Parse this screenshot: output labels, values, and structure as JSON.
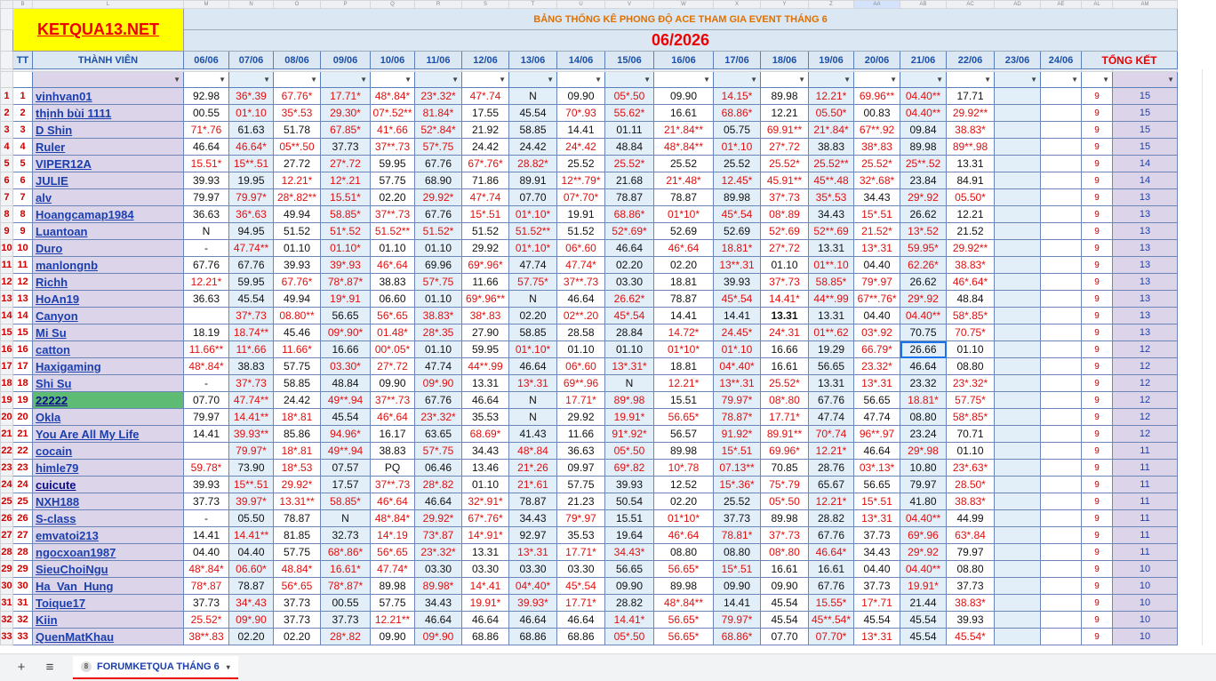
{
  "app": {
    "title": "KETQUA13.NET",
    "subtitle": "BẢNG THỐNG KÊ PHONG ĐỘ ACE THAM GIA EVENT THÁNG 6",
    "month": "06/2026"
  },
  "column_letters": [
    "",
    "B",
    "L",
    "M",
    "N",
    "O",
    "P",
    "Q",
    "R",
    "S",
    "T",
    "U",
    "V",
    "W",
    "X",
    "Y",
    "Z",
    "AA",
    "AB",
    "AC",
    "AD",
    "AE",
    "AL",
    "AM"
  ],
  "header": {
    "tt": "TT",
    "member": "THÀNH VIÊN",
    "dates": [
      "06/06",
      "07/06",
      "08/06",
      "09/06",
      "10/06",
      "11/06",
      "12/06",
      "13/06",
      "14/06",
      "15/06",
      "16/06",
      "17/06",
      "18/06",
      "19/06",
      "20/06",
      "21/06",
      "22/06",
      "23/06",
      "24/06"
    ],
    "summary": "TỔNG KẾT"
  },
  "rows": [
    {
      "tt": "1",
      "name": "vinhvan01",
      "vals": [
        "92.98",
        "36*.39",
        "67.76*",
        "17.71*",
        "48*.84*",
        "23*.32*",
        "47*.74",
        "N",
        "09.90",
        "05*.50",
        "09.90",
        "14.15*",
        "89.98",
        "12.21*",
        "69.96**",
        "04.40**",
        "17.71",
        "",
        ""
      ],
      "g": "9",
      "t": "15"
    },
    {
      "tt": "2",
      "name": "thịnh bùi 1111",
      "vals": [
        "00.55",
        "01*.10",
        "35*.53",
        "29.30*",
        "07*.52**",
        "81.84*",
        "17.55",
        "45.54",
        "70*.93",
        "55.62*",
        "16.61",
        "68.86*",
        "12.21",
        "05.50*",
        "00.83",
        "04.40**",
        "29.92**",
        "",
        ""
      ],
      "g": "9",
      "t": "15"
    },
    {
      "tt": "3",
      "name": "D Shin",
      "vals": [
        "71*.76",
        "61.63",
        "51.78",
        "67.85*",
        "41*.66",
        "52*.84*",
        "21.92",
        "58.85",
        "14.41",
        "01.11",
        "21*.84**",
        "05.75",
        "69.91**",
        "21*.84*",
        "67**.92",
        "09.84",
        "38.83*",
        "",
        ""
      ],
      "g": "9",
      "t": "15"
    },
    {
      "tt": "4",
      "name": "Ruler",
      "vals": [
        "46.64",
        "46.64*",
        "05**.50",
        "37.73",
        "37**.73",
        "57*.75",
        "24.42",
        "24.42",
        "24*.42",
        "48.84",
        "48*.84**",
        "01*.10",
        "27*.72",
        "38.83",
        "38*.83",
        "89.98",
        "89**.98",
        "",
        ""
      ],
      "g": "9",
      "t": "15"
    },
    {
      "tt": "5",
      "name": "VIPER12A",
      "vals": [
        "15.51*",
        "15**.51",
        "27.72",
        "27*.72",
        "59.95",
        "67.76",
        "67*.76*",
        "28.82*",
        "25.52",
        "25.52*",
        "25.52",
        "25.52",
        "25.52*",
        "25.52**",
        "25.52*",
        "25**.52",
        "13.31",
        "",
        ""
      ],
      "g": "9",
      "t": "14"
    },
    {
      "tt": "6",
      "name": "JULIE",
      "vals": [
        "39.93",
        "19.95",
        "12.21*",
        "12*.21",
        "57.75",
        "68.90",
        "71.86",
        "89.91",
        "12**.79*",
        "21.68",
        "21*.48*",
        "12.45*",
        "45.91**",
        "45**.48",
        "32*.68*",
        "23.84",
        "84.91",
        "",
        ""
      ],
      "g": "9",
      "t": "14"
    },
    {
      "tt": "7",
      "name": "alv",
      "vals": [
        "79.97",
        "79.97*",
        "28*.82**",
        "15.51*",
        "02.20",
        "29.92*",
        "47*.74",
        "07.70",
        "07*.70*",
        "78.87",
        "78.87",
        "89.98",
        "37*.73",
        "35*.53",
        "34.43",
        "29*.92",
        "05.50*",
        "",
        ""
      ],
      "g": "9",
      "t": "13"
    },
    {
      "tt": "8",
      "name": "Hoangcamap1984",
      "vals": [
        "36.63",
        "36*.63",
        "49.94",
        "58.85*",
        "37**.73",
        "67.76",
        "15*.51",
        "01*.10*",
        "19.91",
        "68.86*",
        "01*10*",
        "45*.54",
        "08*.89",
        "34.43",
        "15*.51",
        "26.62",
        "12.21",
        "",
        ""
      ],
      "g": "9",
      "t": "13"
    },
    {
      "tt": "9",
      "name": "Luantoan",
      "vals": [
        "N",
        "94.95",
        "51.52",
        "51*.52",
        "51.52**",
        "51.52*",
        "51.52",
        "51.52**",
        "51.52",
        "52*.69*",
        "52.69",
        "52.69",
        "52*.69",
        "52**.69",
        "21.52*",
        "13*.52",
        "21.52",
        "",
        ""
      ],
      "g": "9",
      "t": "13"
    },
    {
      "tt": "10",
      "name": "Duro",
      "vals": [
        "-",
        "47.74**",
        "01.10",
        "01.10*",
        "01.10",
        "01.10",
        "29.92",
        "01*.10*",
        "06*.60",
        "46.64",
        "46*.64",
        "18.81*",
        "27*.72",
        "13.31",
        "13*.31",
        "59.95*",
        "29.92**",
        "",
        ""
      ],
      "g": "9",
      "t": "13"
    },
    {
      "tt": "11",
      "name": "manlongnb",
      "vals": [
        "67.76",
        "67.76",
        "39.93",
        "39*.93",
        "46*.64",
        "69.96",
        "69*.96*",
        "47.74",
        "47.74*",
        "02.20",
        "02.20",
        "13**.31",
        "01.10",
        "01**.10",
        "04.40",
        "62.26*",
        "38.83*",
        "",
        ""
      ],
      "g": "9",
      "t": "13"
    },
    {
      "tt": "12",
      "name": "Richh",
      "vals": [
        "12.21*",
        "59.95",
        "67.76*",
        "78*.87*",
        "38.83",
        "57*.75",
        "11.66",
        "57.75*",
        "37**.73",
        "03.30",
        "18.81",
        "39.93",
        "37*.73",
        "58.85*",
        "79*.97",
        "26.62",
        "46*.64*",
        "",
        ""
      ],
      "g": "9",
      "t": "13"
    },
    {
      "tt": "13",
      "name": "HoAn19",
      "vals": [
        "36.63",
        "45.54",
        "49.94",
        "19*.91",
        "06.60",
        "01.10",
        "69*.96**",
        "N",
        "46.64",
        "26.62*",
        "78.87",
        "45*.54",
        "14.41*",
        "44**.99",
        "67**.76*",
        "29*.92",
        "48.84",
        "",
        ""
      ],
      "g": "9",
      "t": "13"
    },
    {
      "tt": "14",
      "name": "Canyon",
      "vals": [
        "",
        "37*.73",
        "08.80**",
        "56.65",
        "56*.65",
        "38.83*",
        "38*.83",
        "02.20",
        "02**.20",
        "45*.54",
        "14.41",
        "14.41",
        "13.31",
        "13.31",
        "04.40",
        "04.40**",
        "58*.85*",
        "",
        ""
      ],
      "g": "9",
      "t": "13"
    },
    {
      "tt": "15",
      "name": "Mi Su",
      "vals": [
        "18.19",
        "18.74**",
        "45.46",
        "09*.90*",
        "01.48*",
        "28*.35",
        "27.90",
        "58.85",
        "28.58",
        "28.84",
        "14.72*",
        "24.45*",
        "24*.31",
        "01**.62",
        "03*.92",
        "70.75",
        "70.75*",
        "",
        ""
      ],
      "g": "9",
      "t": "13"
    },
    {
      "tt": "16",
      "name": "catton",
      "vals": [
        "11.66**",
        "11*.66",
        "11.66*",
        "16.66",
        "00*.05*",
        "01.10",
        "59.95",
        "01*.10*",
        "01.10",
        "01.10",
        "01*10*",
        "01*.10",
        "16.66",
        "19.29",
        "66.79*",
        "26.66",
        "01.10",
        "",
        ""
      ],
      "g": "9",
      "t": "12"
    },
    {
      "tt": "17",
      "name": "Haxigaming",
      "vals": [
        "48*.84*",
        "38.83",
        "57.75",
        "03.30*",
        "27*.72",
        "47.74",
        "44**.99",
        "46.64",
        "06*.60",
        "13*.31*",
        "18.81",
        "04*.40*",
        "16.61",
        "56.65",
        "23.32*",
        "46.64",
        "08.80",
        "",
        ""
      ],
      "g": "9",
      "t": "12"
    },
    {
      "tt": "18",
      "name": "Shi Su",
      "vals": [
        "-",
        "37*.73",
        "58.85",
        "48.84",
        "09.90",
        "09*.90",
        "13.31",
        "13*.31",
        "69**.96",
        "N",
        "12.21*",
        "13**.31",
        "25.52*",
        "13.31",
        "13*.31",
        "23.32",
        "23*.32*",
        "",
        ""
      ],
      "g": "9",
      "t": "12"
    },
    {
      "tt": "19",
      "name": "22222",
      "vals": [
        "07.70",
        "47.74**",
        "24.42",
        "49**.94",
        "37**.73",
        "67.76",
        "46.64",
        "N",
        "17.71*",
        "89*.98",
        "15.51",
        "79.97*",
        "08*.80",
        "67.76",
        "56.65",
        "18.81*",
        "57.75*",
        "",
        ""
      ],
      "g": "9",
      "t": "12"
    },
    {
      "tt": "20",
      "name": "Okla",
      "vals": [
        "79.97",
        "14.41**",
        "18*.81",
        "45.54",
        "46*.64",
        "23*.32*",
        "35.53",
        "N",
        "29.92",
        "19.91*",
        "56.65*",
        "78.87*",
        "17.71*",
        "47.74",
        "47.74",
        "08.80",
        "58*.85*",
        "",
        ""
      ],
      "g": "9",
      "t": "12"
    },
    {
      "tt": "21",
      "name": "You Are All My Life",
      "vals": [
        "14.41",
        "39.93**",
        "85.86",
        "94.96*",
        "16.17",
        "63.65",
        "68.69*",
        "41.43",
        "11.66",
        "91*.92*",
        "56.57",
        "91.92*",
        "89.91**",
        "70*.74",
        "96**.97",
        "23.24",
        "70.71",
        "",
        ""
      ],
      "g": "9",
      "t": "12"
    },
    {
      "tt": "22",
      "name": "cocain",
      "vals": [
        "",
        "79.97*",
        "18*.81",
        "49**.94",
        "38.83",
        "57*.75",
        "34.43",
        "48*.84",
        "36.63",
        "05*.50",
        "89.98",
        "15*.51",
        "69.96*",
        "12.21*",
        "46.64",
        "29*.98",
        "01.10",
        "",
        ""
      ],
      "g": "9",
      "t": "11"
    },
    {
      "tt": "23",
      "name": "himle79",
      "vals": [
        "59.78*",
        "73.90",
        "18*.53",
        "07.57",
        "PQ",
        "06.46",
        "13.46",
        "21*.26",
        "09.97",
        "69*.82",
        "10*.78",
        "07.13**",
        "70.85",
        "28.76",
        "03*.13*",
        "10.80",
        "23*.63*",
        "",
        ""
      ],
      "g": "9",
      "t": "11"
    },
    {
      "tt": "24",
      "name": "cuicute",
      "vals": [
        "39.93",
        "15**.51",
        "29.92*",
        "17.57",
        "37**.73",
        "28*.82",
        "01.10",
        "21*.61",
        "57.75",
        "39.93",
        "12.52",
        "15*.36*",
        "75*.79",
        "65.67",
        "56.65",
        "79.97",
        "28.50*",
        "",
        ""
      ],
      "g": "9",
      "t": "11"
    },
    {
      "tt": "25",
      "name": "NXH188",
      "vals": [
        "37.73",
        "39.97*",
        "13.31**",
        "58.85*",
        "46*.64",
        "46.64",
        "32*.91*",
        "78.87",
        "21.23",
        "50.54",
        "02.20",
        "25.52",
        "05*.50",
        "12.21*",
        "15*.51",
        "41.80",
        "38.83*",
        "",
        ""
      ],
      "g": "9",
      "t": "11"
    },
    {
      "tt": "26",
      "name": "S-class",
      "vals": [
        "-",
        "05.50",
        "78.87",
        "N",
        "48*.84*",
        "29.92*",
        "67*.76*",
        "34.43",
        "79*.97",
        "15.51",
        "01*10*",
        "37.73",
        "89.98",
        "28.82",
        "13*.31",
        "04.40**",
        "44.99",
        "",
        ""
      ],
      "g": "9",
      "t": "11"
    },
    {
      "tt": "27",
      "name": "emvatoi213",
      "vals": [
        "14.41",
        "14.41**",
        "81.85",
        "32.73",
        "14*.19",
        "73*.87",
        "14*.91*",
        "92.97",
        "35.53",
        "19.64",
        "46*.64",
        "78.81*",
        "37*.73",
        "67.76",
        "37.73",
        "69*.96",
        "63*.84",
        "",
        ""
      ],
      "g": "9",
      "t": "11"
    },
    {
      "tt": "28",
      "name": "ngocxoan1987",
      "vals": [
        "04.40",
        "04.40",
        "57.75",
        "68*.86*",
        "56*.65",
        "23*.32*",
        "13.31",
        "13*.31",
        "17.71*",
        "34.43*",
        "08.80",
        "08.80",
        "08*.80",
        "46.64*",
        "34.43",
        "29*.92",
        "79.97",
        "",
        ""
      ],
      "g": "9",
      "t": "11"
    },
    {
      "tt": "29",
      "name": "SieuChoiNgu",
      "vals": [
        "48*.84*",
        "06.60*",
        "48.84*",
        "16.61*",
        "47.74*",
        "03.30",
        "03.30",
        "03.30",
        "03.30",
        "56.65",
        "56.65*",
        "15*.51",
        "16.61",
        "16.61",
        "04.40",
        "04.40**",
        "08.80",
        "",
        ""
      ],
      "g": "9",
      "t": "10"
    },
    {
      "tt": "30",
      "name": "Ha_Van_Hung",
      "vals": [
        "78*.87",
        "78.87",
        "56*.65",
        "78*.87*",
        "89.98",
        "89.98*",
        "14*.41",
        "04*.40*",
        "45*.54",
        "09.90",
        "89.98",
        "09.90",
        "09.90",
        "67.76",
        "37.73",
        "19.91*",
        "37.73",
        "",
        ""
      ],
      "g": "9",
      "t": "10"
    },
    {
      "tt": "31",
      "name": "Toique17",
      "vals": [
        "37.73",
        "34*.43",
        "37.73",
        "00.55",
        "57.75",
        "34.43",
        "19.91*",
        "39.93*",
        "17.71*",
        "28.82",
        "48*.84**",
        "14.41",
        "45.54",
        "15.55*",
        "17*.71",
        "21.44",
        "38.83*",
        "",
        ""
      ],
      "g": "9",
      "t": "10"
    },
    {
      "tt": "32",
      "name": "Kiin",
      "vals": [
        "25.52*",
        "09*.90",
        "37.73",
        "37.73",
        "12.21**",
        "46.64",
        "46.64",
        "46.64",
        "46.64",
        "14.41*",
        "56.65*",
        "79.97*",
        "45.54",
        "45**.54*",
        "45.54",
        "45.54",
        "39.93",
        "",
        ""
      ],
      "g": "9",
      "t": "10"
    },
    {
      "tt": "33",
      "name": "QuenMatKhau",
      "vals": [
        "38**.83",
        "02.20",
        "02.20",
        "28*.82",
        "09.90",
        "09*.90",
        "68.86",
        "68.86",
        "68.86",
        "05*.50",
        "56.65*",
        "68.86*",
        "07.70",
        "07.70*",
        "13*.31",
        "45.54",
        "45.54*",
        "",
        ""
      ],
      "g": "9",
      "t": "10"
    }
  ],
  "tabbar": {
    "add_icon": "+",
    "menu_icon": "≡",
    "sheet_badge": "8",
    "sheet_name": "FORUMKETQUA THÁNG 6",
    "caret": "▾"
  },
  "colors": {
    "accent_red": "#e01010",
    "header_blue": "#1b4fa8",
    "name_purple": "#dcd5ea",
    "alt_blue": "#e2eef8",
    "logo_yellow": "#ffff00",
    "highlight_green": "#5dbb74"
  }
}
